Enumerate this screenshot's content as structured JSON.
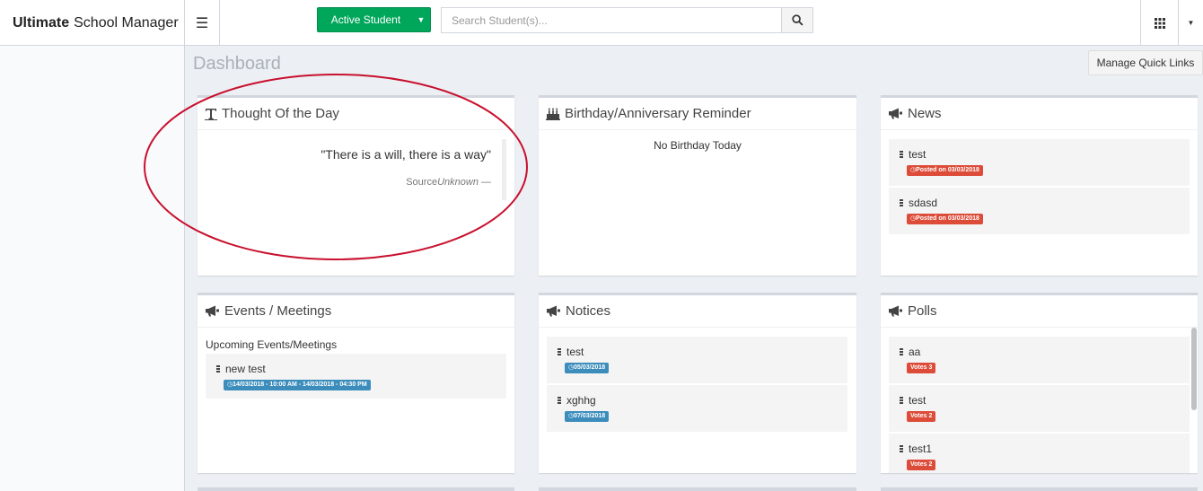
{
  "header": {
    "brand_bold": "Ultimate",
    "brand_rest": "School Manager",
    "menu_icon": "hamburger-icon",
    "student_button": "Active Student",
    "search_placeholder": "Search Student(s)...",
    "search_icon": "search-icon",
    "apps_icon": "grid-icon"
  },
  "page": {
    "title": "Dashboard",
    "quick_links_label": "Manage Quick Links"
  },
  "thought": {
    "title": "Thought Of the Day",
    "quote": "\"There is a will, there is a way\"",
    "source_label": "Source",
    "source_value": "Unknown",
    "source_dash": " —"
  },
  "birthday": {
    "title": "Birthday/Anniversary Reminder",
    "empty_text": "No Birthday Today"
  },
  "news": {
    "title": "News",
    "items": [
      {
        "title": "test",
        "badge": "Posted on 03/03/2018"
      },
      {
        "title": "sdasd",
        "badge": "Posted on 03/03/2018"
      }
    ]
  },
  "events": {
    "title": "Events / Meetings",
    "subtitle": "Upcoming Events/Meetings",
    "items": [
      {
        "title": "new test",
        "badge": "14/03/2018 - 10:00 AM - 14/03/2018 - 04:30 PM"
      }
    ]
  },
  "notices": {
    "title": "Notices",
    "items": [
      {
        "title": "test",
        "badge": "05/03/2018"
      },
      {
        "title": "xghhg",
        "badge": "07/03/2018"
      }
    ]
  },
  "polls": {
    "title": "Polls",
    "items": [
      {
        "title": "aa",
        "badge": "Votes 3"
      },
      {
        "title": "test",
        "badge": "Votes 2"
      },
      {
        "title": "test1",
        "badge": "Votes 2"
      }
    ]
  },
  "colors": {
    "success": "#00a65a",
    "danger": "#dd4b39",
    "info": "#3c8dbc",
    "annotation": "#c8102e"
  }
}
